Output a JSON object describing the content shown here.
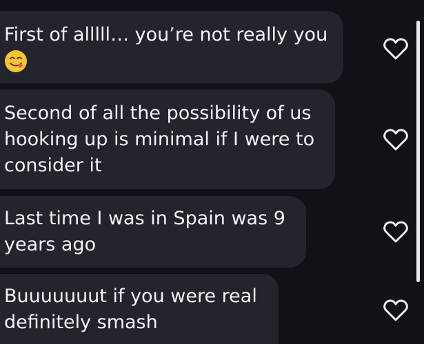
{
  "messages": [
    {
      "text": "First of alllll… you’re not really you",
      "emoji": "yum-face-emoji"
    },
    {
      "text": "Second of all the possibility of us\nhooking up is minimal if I were to\nconsider it"
    },
    {
      "text": "Last time I was in Spain was 9\nyears ago"
    },
    {
      "text": "Buuuuuuut if you were real\ndefinitely smash"
    }
  ],
  "icons": {
    "like": "heart-outline-icon"
  },
  "colors": {
    "background": "#101217",
    "bubble": "#23252c",
    "text": "#f3f4f6",
    "heart_stroke": "#f0f0f0",
    "scrollbar": "#e9e9ec"
  }
}
